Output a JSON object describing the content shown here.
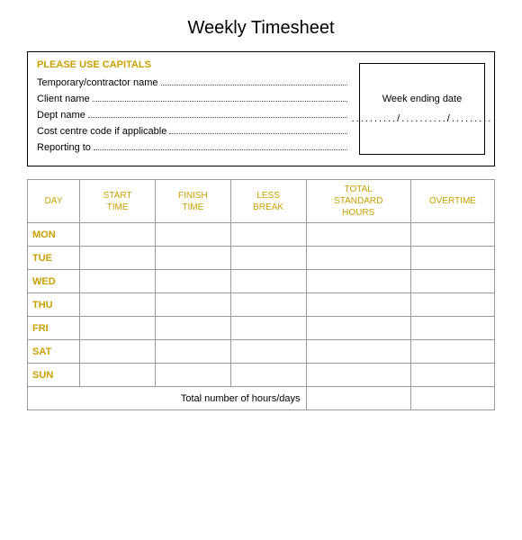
{
  "title": "Weekly Timesheet",
  "infoBox": {
    "header": "PLEASE USE CAPITALS",
    "fields": [
      {
        "label": "Temporary/contractor name"
      },
      {
        "label": "Client name"
      },
      {
        "label": "Dept name"
      },
      {
        "label": "Cost centre code if applicable"
      },
      {
        "label": "Reporting to"
      }
    ],
    "weekEndingLabel": "Week ending date",
    "weekEndingValue": "........../........../........."
  },
  "table": {
    "headers": [
      "DAY",
      "START TIME",
      "FINISH TIME",
      "LESS BREAK",
      "TOTAL STANDARD HOURS",
      "OVERTIME"
    ],
    "days": [
      "MON",
      "TUE",
      "WED",
      "THU",
      "FRI",
      "SAT",
      "SUN"
    ],
    "totalLabel": "Total number of hours/days"
  }
}
